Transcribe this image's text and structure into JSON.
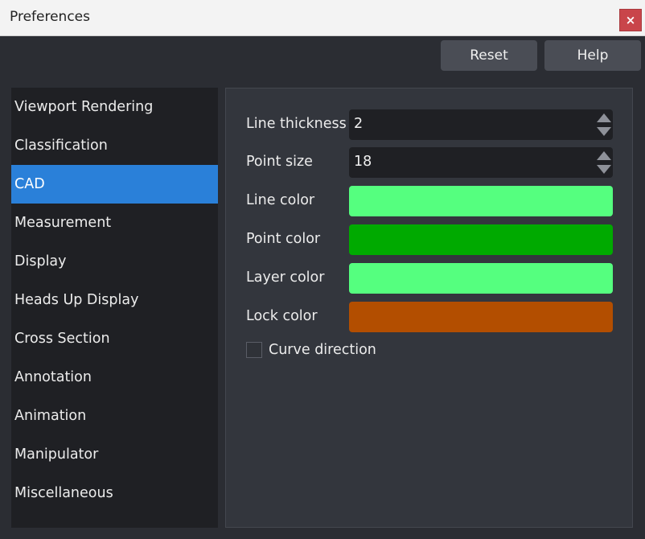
{
  "window": {
    "title": "Preferences",
    "close_glyph": "×"
  },
  "toolbar": {
    "reset_label": "Reset",
    "help_label": "Help"
  },
  "sidebar": {
    "items": [
      {
        "label": "Viewport Rendering"
      },
      {
        "label": "Classification"
      },
      {
        "label": "CAD",
        "active": true
      },
      {
        "label": "Measurement"
      },
      {
        "label": "Display"
      },
      {
        "label": "Heads Up Display"
      },
      {
        "label": "Cross Section"
      },
      {
        "label": "Annotation"
      },
      {
        "label": "Animation"
      },
      {
        "label": "Manipulator"
      },
      {
        "label": "Miscellaneous"
      }
    ]
  },
  "cad": {
    "line_thickness": {
      "label": "Line thickness",
      "value": "2"
    },
    "point_size": {
      "label": "Point size",
      "value": "18"
    },
    "line_color": {
      "label": "Line color",
      "color": "#55ff7f"
    },
    "point_color": {
      "label": "Point color",
      "color": "#00aa00"
    },
    "layer_color": {
      "label": "Layer color",
      "color": "#55ff7f"
    },
    "lock_color": {
      "label": "Lock color",
      "color": "#b34e00"
    },
    "curve_direction": {
      "label": "Curve direction",
      "checked": false
    }
  },
  "icons": {
    "spin_up": "triangle-up-icon",
    "spin_down": "triangle-down-icon"
  }
}
